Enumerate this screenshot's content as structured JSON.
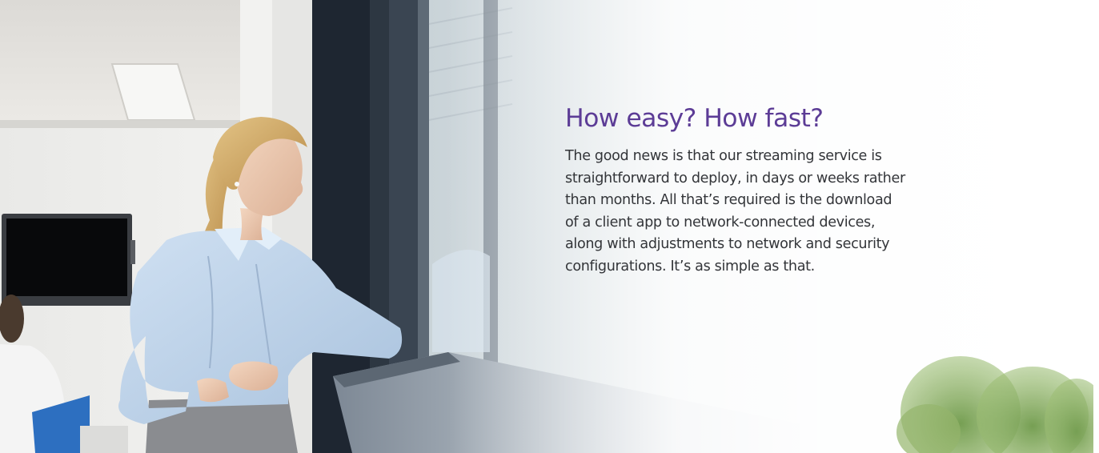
{
  "hero": {
    "heading": "How easy? How fast?",
    "paragraph_lines": [
      "The good news is that our streaming service is",
      "straightforward to deploy, in days or weeks rather",
      "than months. All that’s required is the download",
      "of a client app to network-connected devices,",
      "along with adjustments to network and security",
      "configurations. It’s as simple as that."
    ],
    "image_alt": "Businesswoman in a light blue shirt leaning on a window ledge in a bright office, looking out the window",
    "colors": {
      "heading": "#5c3c96",
      "body": "#333539"
    }
  }
}
